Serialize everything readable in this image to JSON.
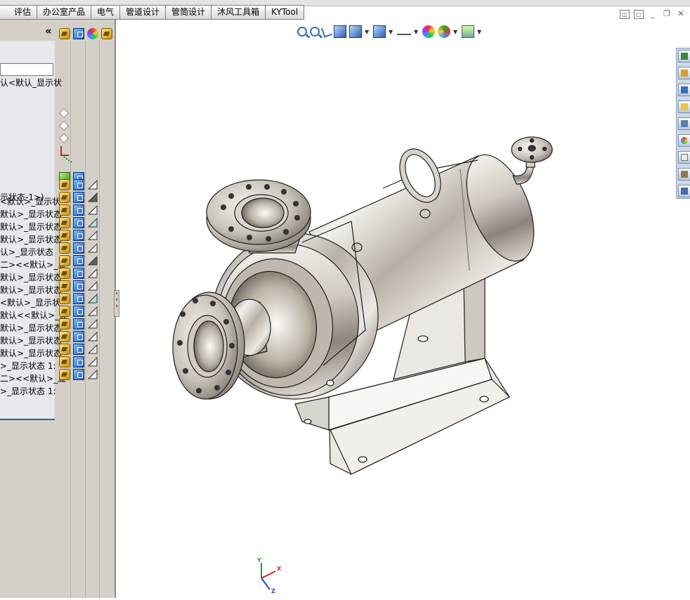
{
  "menu_tabs": [
    "评估",
    "办公室产品",
    "电气",
    "管道设计",
    "管筒设计",
    "沐风工具箱",
    "KYTool"
  ],
  "window_controls": {
    "tile": "◫",
    "restore_small": "▢",
    "minimize": "_",
    "restore": "❐",
    "close": "✕"
  },
  "feature_manager": {
    "collapse_glyph": "«",
    "header_icons": [
      "assembly-icon",
      "part-icon",
      "appearance-icon",
      "display-states-icon"
    ],
    "config_name": "认<默认_显示状",
    "root_state": "示状态-1>)",
    "rows": [
      {
        "text": "<默认>_显示状",
        "tri_color": "#f0f0f0"
      },
      {
        "text": "默认>_显示状态",
        "tri_color": "#606060"
      },
      {
        "text": "默认>_显示状态",
        "tri_color": "#f0f0f0"
      },
      {
        "text": "默认>_显示状态",
        "tri_color": "#aee4e4"
      },
      {
        "text": "认>_显示状态",
        "tri_color": "#f0f0f0"
      },
      {
        "text": "二><<默认>_显",
        "tri_color": "#f0f0f0"
      },
      {
        "text": "默认>_显示状态",
        "tri_color": "#606060"
      },
      {
        "text": "默认>_显示状态",
        "tri_color": "#f0f0f0"
      },
      {
        "text": "<默认>_显示状",
        "tri_color": "#f0f0f0"
      },
      {
        "text": "默认<<默认>_显",
        "tri_color": "#aee4e4"
      },
      {
        "text": "默认>_显示状态",
        "tri_color": "#f0f0f0"
      },
      {
        "text": "默认>_显示状态",
        "tri_color": "#f0f0f0"
      },
      {
        "text": "默认>_显示状态",
        "tri_color": "#f0f0f0"
      },
      {
        "text": ">_显示状态 1:",
        "tri_color": "#f0f0f0"
      },
      {
        "text": "二><<默认>_显",
        "tri_color": "#f0f0f0"
      },
      {
        "text": ">_显示状态 1:",
        "tri_color": "#f0f0f0"
      }
    ],
    "scroll_arrow": "▸"
  },
  "headsup_toolbar": [
    "zoom-to-fit-icon",
    "zoom-to-area-icon",
    "previous-view-icon",
    "section-view-icon",
    "view-orientation-icon",
    "display-style-icon",
    "hide-show-items-icon",
    "edit-appearance-icon",
    "apply-scene-icon",
    "view-settings-icon"
  ],
  "task_pane": [
    "solidworks-resources-icon",
    "home-icon",
    "design-library-icon",
    "file-explorer-icon",
    "view-palette-icon",
    "appearances-icon",
    "custom-properties-icon",
    "toolbox-icon",
    "network-icon"
  ],
  "triad": {
    "x": "X",
    "y": "Y",
    "z": "Z"
  },
  "colors": {
    "panel_bg": "#d4d0c8",
    "tree_bg": "#e6e8ed",
    "selection_blue": "#2b5ea8"
  }
}
